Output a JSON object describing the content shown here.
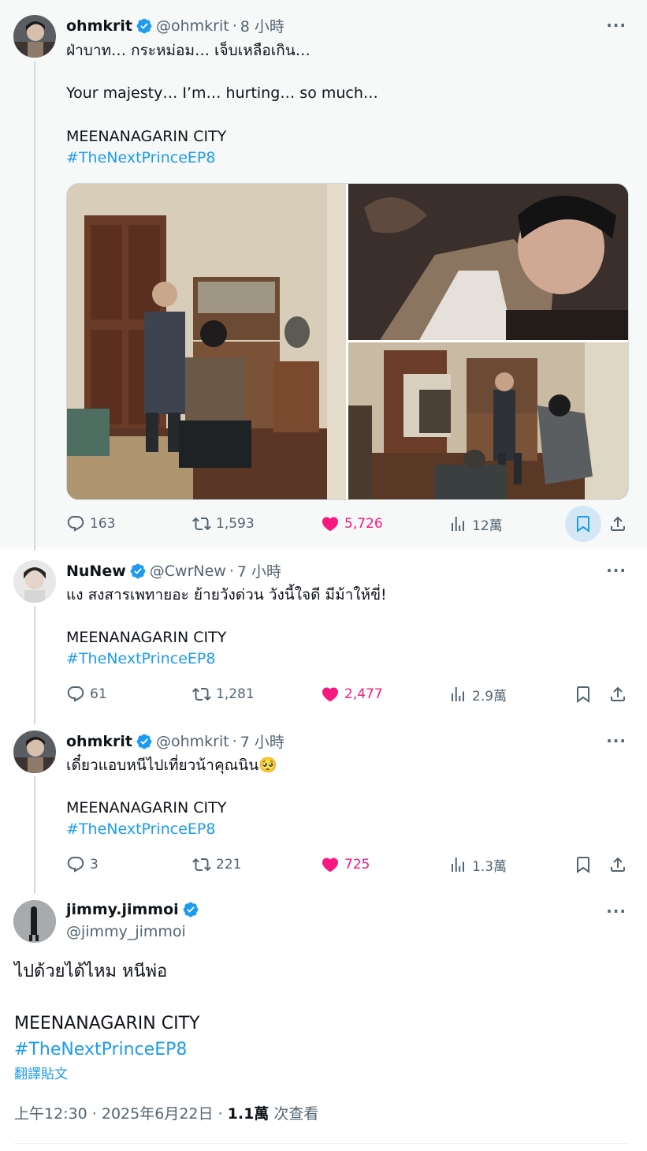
{
  "tweet1": {
    "name": "ohmkrit",
    "handle": "@ohmkrit",
    "time": "8 小時",
    "line1": "ฝ่าบาท… กระหม่อม… เจ็บเหลือเกิน…",
    "line2": "Your majesty… I’m… hurting… so much…",
    "line3": "MEENANAGARIN CITY",
    "hashtag": "#TheNextPrinceEP8",
    "replies": "163",
    "retweets": "1,593",
    "likes": "5,726",
    "views": "12萬"
  },
  "tweet2": {
    "name": "NuNew",
    "handle": "@CwrNew",
    "time": "7 小時",
    "line1": "แง สงสารเพทายอะ ย้ายวังด่วน วังนี้ใจดี มีม้าให้ขี่!",
    "line2": "MEENANAGARIN CITY",
    "hashtag": "#TheNextPrinceEP8",
    "replies": "61",
    "retweets": "1,281",
    "likes": "2,477",
    "views": "2.9萬"
  },
  "tweet3": {
    "name": "ohmkrit",
    "handle": "@ohmkrit",
    "time": "7 小時",
    "line1": "เดี๋ยวแอบหนีไปเที่ยวน้าคุณนิน🥺",
    "line2": "MEENANAGARIN CITY",
    "hashtag": "#TheNextPrinceEP8",
    "replies": "3",
    "retweets": "221",
    "likes": "725",
    "views": "1.3萬"
  },
  "main": {
    "name": "jimmy.jimmoi",
    "handle": "@jimmy_jimmoi",
    "line1": "ไปด้วยได้ไหม หนีพ่อ",
    "line2": "MEENANAGARIN CITY",
    "hashtag": "#TheNextPrinceEP8",
    "translate": "翻譯貼文",
    "timestamp": "上午12:30 · 2025年6月22日 · ",
    "views_count": "1.1萬",
    "views_label": " 次查看"
  },
  "ui": {
    "separator": "·",
    "more": "···"
  },
  "colors": {
    "accent": "#1d9bf0",
    "like": "#f91880",
    "muted": "#536471",
    "highlight_bg": "#f7f9f9"
  }
}
